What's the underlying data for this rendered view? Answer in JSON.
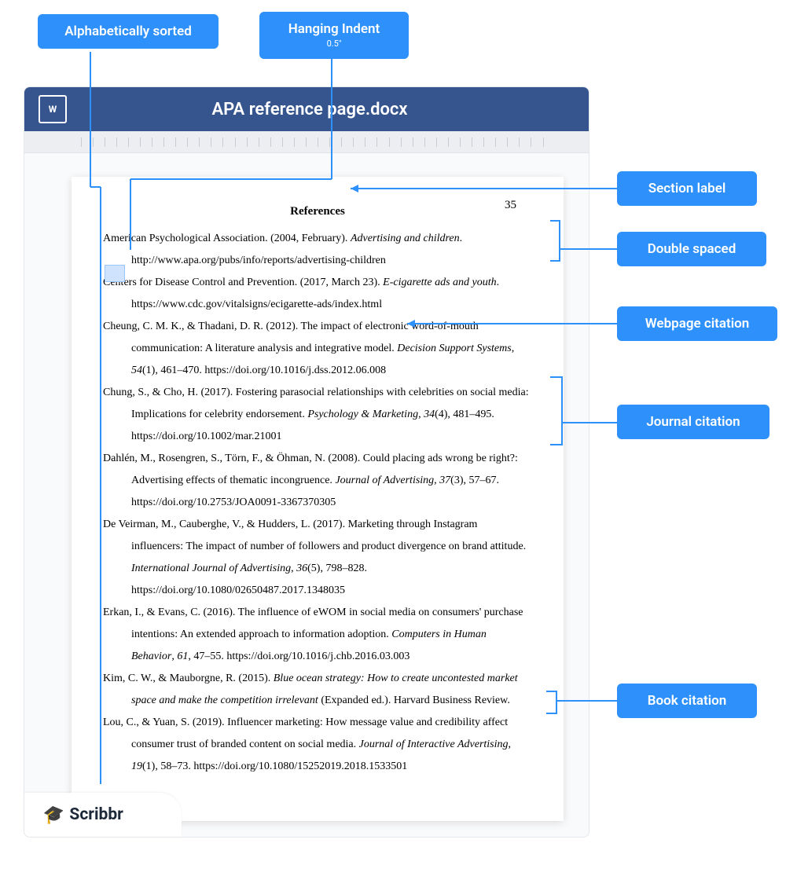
{
  "callouts": {
    "alpha_sorted": "Alphabetically sorted",
    "hanging": "Hanging Indent",
    "hanging_sub": "0.5\"",
    "section_label": "Section label",
    "double_spaced": "Double spaced",
    "webpage_citation": "Webpage citation",
    "journal_citation": "Journal citation",
    "book_citation": "Book citation"
  },
  "word_icon_letter": "W",
  "titlebar": "APA reference page.docx",
  "page_number": "35",
  "refs_title": "References",
  "references": [
    "American Psychological Association. (2004, February). <em>Advertising and children</em>. http://www.apa.org/pubs/info/reports/advertising-children",
    "Centers for Disease Control and Prevention. (2017, March 23). <em>E-cigarette ads and youth</em>. https://www.cdc.gov/vitalsigns/ecigarette-ads/index.html",
    "Cheung, C. M. K., & Thadani, D. R. (2012). The impact of electronic word-of-mouth communication: A literature analysis and integrative model. <em>Decision Support Systems</em>, <em>54</em>(1), 461–470. https://doi.org/10.1016/j.dss.2012.06.008",
    "Chung, S., & Cho, H. (2017). Fostering parasocial relationships with celebrities on social media: Implications for celebrity endorsement. <em>Psychology & Marketing</em>, <em>34</em>(4), 481–495. https://doi.org/10.1002/mar.21001",
    "Dahlén, M., Rosengren, S., Törn, F., & Öhman, N. (2008). Could placing ads wrong be right?: Advertising effects of thematic incongruence. <em>Journal of Advertising</em>, <em>37</em>(3), 57–67. https://doi.org/10.2753/JOA0091-3367370305",
    "De Veirman, M., Cauberghe, V., & Hudders, L. (2017). Marketing through Instagram influencers: The impact of number of followers and product divergence on brand attitude. <em>International Journal of Advertising</em>, <em>36</em>(5), 798–828. https://doi.org/10.1080/02650487.2017.1348035",
    "Erkan, I., & Evans, C. (2016). The influence of eWOM in social media on consumers' purchase intentions: An extended approach to information adoption. <em>Computers in Human Behavior</em>, <em>61</em>, 47–55. https://doi.org/10.1016/j.chb.2016.03.003",
    "Kim, C. W., & Mauborgne, R. (2015). <em>Blue ocean strategy: How to create uncontested market space and make the competition irrelevant</em> (Expanded ed.). Harvard Business Review.",
    "Lou, C., & Yuan, S. (2019). Influencer marketing: How message value and credibility affect consumer trust of branded content on social media. <em>Journal of Interactive Advertising</em>, <em>19</em>(1), 58–73. https://doi.org/10.1080/15252019.2018.1533501"
  ],
  "logo_text": "Scribbr"
}
